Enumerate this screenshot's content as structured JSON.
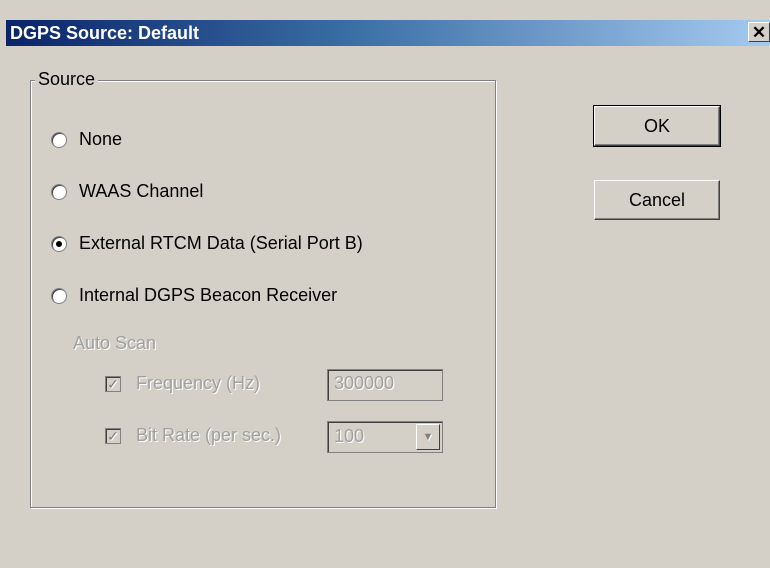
{
  "window": {
    "title": "DGPS Source: Default",
    "close_glyph": "✕"
  },
  "source_group": {
    "label": "Source",
    "options": [
      {
        "label": "None",
        "checked": false
      },
      {
        "label": "WAAS Channel",
        "checked": false
      },
      {
        "label": "External RTCM Data (Serial Port B)",
        "checked": true
      },
      {
        "label": "Internal DGPS Beacon Receiver",
        "checked": false
      }
    ],
    "auto_scan": {
      "label": "Auto Scan",
      "frequency": {
        "label": "Frequency (Hz)",
        "checked": true,
        "value": "300000"
      },
      "bit_rate": {
        "label": "Bit Rate (per sec.)",
        "checked": true,
        "value": "100"
      }
    }
  },
  "buttons": {
    "ok": "OK",
    "cancel": "Cancel"
  },
  "colors": {
    "titlebar_start": "#0a246a",
    "titlebar_end": "#a6caf0",
    "face": "#d4d0c8",
    "disabled_text": "#a0a0a0"
  }
}
